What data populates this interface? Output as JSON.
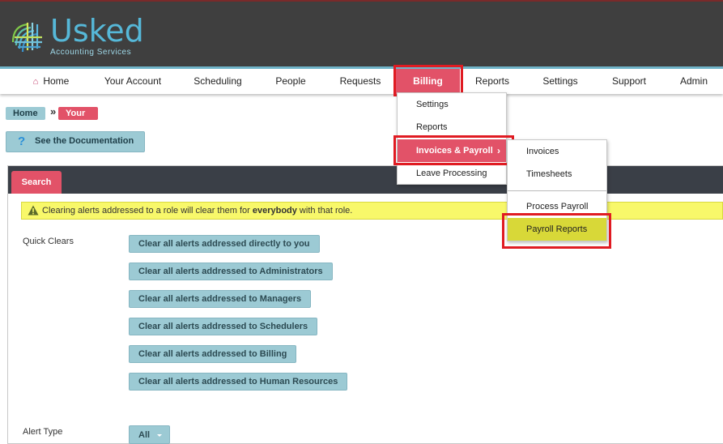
{
  "logo": {
    "wordmark": "Usked",
    "tagline": "Accounting Services"
  },
  "nav": {
    "home": "Home",
    "your_account": "Your Account",
    "scheduling": "Scheduling",
    "people": "People",
    "requests": "Requests",
    "billing": "Billing",
    "reports": "Reports",
    "settings": "Settings",
    "support": "Support",
    "admin": "Admin"
  },
  "billing_menu": {
    "settings": "Settings",
    "reports": "Reports",
    "invoices_payroll": "Invoices & Payroll",
    "invoices_payroll_arrow": "›",
    "leave_processing": "Leave Processing"
  },
  "invoices_submenu": {
    "invoices": "Invoices",
    "timesheets": "Timesheets",
    "process_payroll": "Process Payroll",
    "payroll_reports": "Payroll Reports"
  },
  "breadcrumb": {
    "home": "Home",
    "separator": "»",
    "current": "Your Alerts"
  },
  "doc_button": {
    "icon": "?",
    "label": "See the Documentation"
  },
  "tabs": {
    "search": "Search"
  },
  "warning": {
    "before": "Clearing alerts addressed to a role will clear them for ",
    "bold": "everybody",
    "after": " with that role."
  },
  "quick_clears": {
    "label": "Quick Clears",
    "buttons": [
      "Clear all alerts addressed directly to you",
      "Clear all alerts addressed to Administrators",
      "Clear all alerts addressed to Managers",
      "Clear all alerts addressed to Schedulers",
      "Clear all alerts addressed to Billing",
      "Clear all alerts addressed to Human Resources"
    ]
  },
  "alert_type": {
    "label": "Alert Type",
    "value": "All"
  },
  "colors": {
    "header_bg": "#3f3f3f",
    "accent_pink": "#e25268",
    "teal_button": "#9ccad4",
    "highlight_red": "#e01b22",
    "warning_yellow": "#f8f86a"
  }
}
